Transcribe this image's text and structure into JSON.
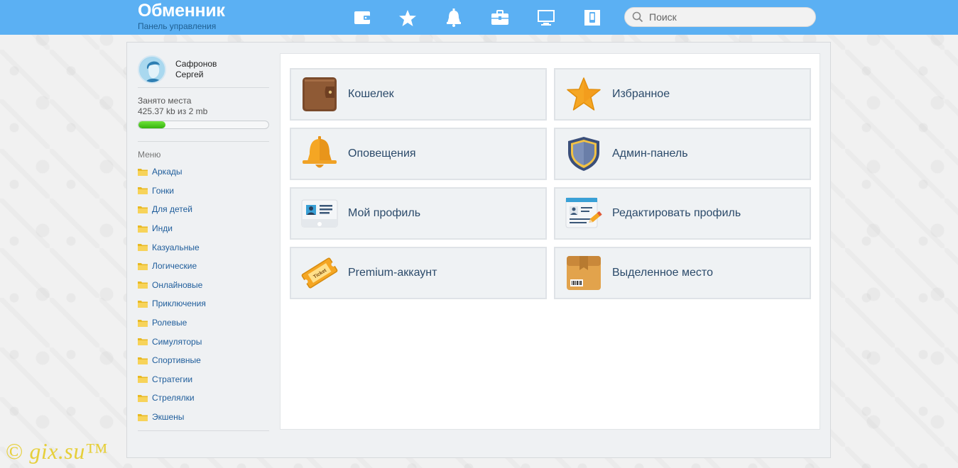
{
  "header": {
    "title": "Обменник",
    "subtitle": "Панель управления",
    "icons": [
      "wallet-icon",
      "star-icon",
      "bell-icon",
      "briefcase-icon",
      "monitor-icon",
      "phone-icon"
    ],
    "search_placeholder": "Поиск"
  },
  "user": {
    "last_name": "Сафронов",
    "first_name": "Сергей"
  },
  "storage": {
    "label": "Занято места",
    "value": "425.37 kb из 2 mb",
    "used_fraction": 0.21
  },
  "menu": {
    "title": "Меню",
    "items": [
      "Аркады",
      "Гонки",
      "Для детей",
      "Инди",
      "Казуальные",
      "Логические",
      "Онлайновые",
      "Приключения",
      "Ролевые",
      "Симуляторы",
      "Спортивные",
      "Стратегии",
      "Стрелялки",
      "Экшены"
    ]
  },
  "tiles": [
    {
      "label": "Кошелек",
      "icon": "wallet-icon"
    },
    {
      "label": "Избранное",
      "icon": "star-icon"
    },
    {
      "label": "Оповещения",
      "icon": "bell-icon"
    },
    {
      "label": "Админ-панель",
      "icon": "shield-icon"
    },
    {
      "label": "Мой профиль",
      "icon": "id-card-icon"
    },
    {
      "label": "Редактировать профиль",
      "icon": "edit-profile-icon"
    },
    {
      "label": "Premium-аккаунт",
      "icon": "ticket-icon"
    },
    {
      "label": "Выделенное место",
      "icon": "box-icon"
    }
  ],
  "ticket_text": "Ticket",
  "watermark": {
    "copyright": "©",
    "text": "gix.su™"
  },
  "colors": {
    "header_bg": "#5bb0f3",
    "link": "#1f5d9b",
    "progress": "#35b20e",
    "watermark": "#e6cf3a"
  }
}
